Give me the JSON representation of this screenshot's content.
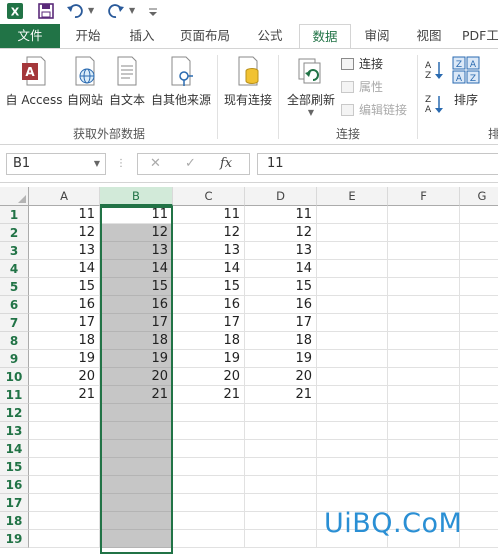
{
  "quick_access": {
    "icons": [
      "excel-icon",
      "save-icon",
      "undo-icon",
      "redo-icon",
      "customize-icon"
    ]
  },
  "tabs": [
    "文件",
    "开始",
    "插入",
    "页面布局",
    "公式",
    "数据",
    "审阅",
    "视图",
    "PDF工"
  ],
  "active_tab": "数据",
  "ribbon": {
    "get_external": {
      "buttons": [
        "自 Access",
        "自网站",
        "自文本",
        "自其他来源",
        "现有连接"
      ],
      "group_label": "获取外部数据"
    },
    "connections": {
      "refresh_label": "全部刷新",
      "items": [
        "连接",
        "属性",
        "编辑链接"
      ],
      "group_label": "连接"
    },
    "sort": {
      "label": "排序",
      "partial_group_label": "排"
    }
  },
  "formula_bar": {
    "name_box": "B1",
    "fx": "fx",
    "value": "11"
  },
  "columns": [
    "A",
    "B",
    "C",
    "D",
    "E",
    "F",
    "G"
  ],
  "selected_column": "B",
  "rows": [
    {
      "num": "1",
      "A": "11",
      "B": "11",
      "C": "11",
      "D": "11"
    },
    {
      "num": "2",
      "A": "12",
      "B": "12",
      "C": "12",
      "D": "12"
    },
    {
      "num": "3",
      "A": "13",
      "B": "13",
      "C": "13",
      "D": "13"
    },
    {
      "num": "4",
      "A": "14",
      "B": "14",
      "C": "14",
      "D": "14"
    },
    {
      "num": "5",
      "A": "15",
      "B": "15",
      "C": "15",
      "D": "15"
    },
    {
      "num": "6",
      "A": "16",
      "B": "16",
      "C": "16",
      "D": "16"
    },
    {
      "num": "7",
      "A": "17",
      "B": "17",
      "C": "17",
      "D": "17"
    },
    {
      "num": "8",
      "A": "18",
      "B": "18",
      "C": "18",
      "D": "18"
    },
    {
      "num": "9",
      "A": "19",
      "B": "19",
      "C": "19",
      "D": "19"
    },
    {
      "num": "10",
      "A": "20",
      "B": "20",
      "C": "20",
      "D": "20"
    },
    {
      "num": "11",
      "A": "21",
      "B": "21",
      "C": "21",
      "D": "21"
    },
    {
      "num": "12",
      "A": "",
      "B": "",
      "C": "",
      "D": ""
    },
    {
      "num": "13",
      "A": "",
      "B": "",
      "C": "",
      "D": ""
    },
    {
      "num": "14",
      "A": "",
      "B": "",
      "C": "",
      "D": ""
    },
    {
      "num": "15",
      "A": "",
      "B": "",
      "C": "",
      "D": ""
    },
    {
      "num": "16",
      "A": "",
      "B": "",
      "C": "",
      "D": ""
    },
    {
      "num": "17",
      "A": "",
      "B": "",
      "C": "",
      "D": ""
    },
    {
      "num": "18",
      "A": "",
      "B": "",
      "C": "",
      "D": ""
    },
    {
      "num": "19",
      "A": "",
      "B": "",
      "C": "",
      "D": ""
    }
  ],
  "watermark": "UiBQ.CoM",
  "colors": {
    "excel_green": "#217346",
    "selection_gray": "#c6c6c6",
    "watermark_blue": "#2a8fd4"
  }
}
